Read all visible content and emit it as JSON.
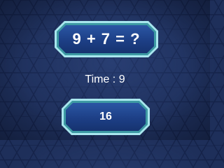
{
  "question": {
    "text": "9 + 7 = ?"
  },
  "timer": {
    "label": "Time : 9"
  },
  "answer": {
    "label": "16"
  },
  "colors": {
    "background": "#1e2f5a",
    "button_fill": "#1d3f86",
    "button_border": "#a8e6ee",
    "text": "#ffffff"
  }
}
